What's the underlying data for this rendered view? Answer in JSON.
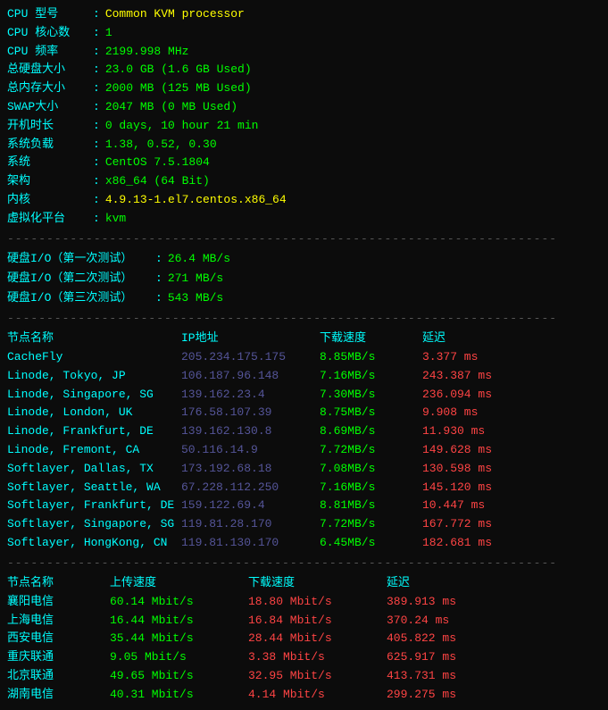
{
  "sysinfo": {
    "rows": [
      {
        "label": "CPU 型号",
        "value": "Common KVM processor",
        "valueClass": "value-yellow"
      },
      {
        "label": "CPU 核心数",
        "value": "1",
        "valueClass": "value"
      },
      {
        "label": "CPU 频率",
        "value": "2199.998 MHz",
        "valueClass": "value"
      },
      {
        "label": "总硬盘大小",
        "value": "23.0 GB (1.6 GB Used)",
        "valueClass": "value"
      },
      {
        "label": "总内存大小",
        "value": "2000 MB (125 MB Used)",
        "valueClass": "value"
      },
      {
        "label": "SWAP大小",
        "value": "2047 MB (0 MB Used)",
        "valueClass": "value"
      },
      {
        "label": "开机时长",
        "value": "0 days, 10 hour 21 min",
        "valueClass": "value"
      },
      {
        "label": "系统负载",
        "value": "1.38, 0.52, 0.30",
        "valueClass": "value"
      },
      {
        "label": "系统",
        "value": "CentOS 7.5.1804",
        "valueClass": "value"
      },
      {
        "label": "架构",
        "value": "x86_64 (64 Bit)",
        "valueClass": "value"
      },
      {
        "label": "内核",
        "value": "4.9.13-1.el7.centos.x86_64",
        "valueClass": "value-yellow"
      },
      {
        "label": "虚拟化平台",
        "value": "kvm",
        "valueClass": "value"
      }
    ]
  },
  "disk_tests": [
    {
      "label": "硬盘I/O（第一次测试）",
      "value": "26.4 MB/s"
    },
    {
      "label": "硬盘I/O（第二次测试）",
      "value": "271 MB/s"
    },
    {
      "label": "硬盘I/O（第三次测试）",
      "value": "543 MB/s"
    }
  ],
  "network_table": {
    "headers": [
      "节点名称",
      "IP地址",
      "下载速度",
      "延迟"
    ],
    "rows": [
      {
        "name": "CacheFly",
        "ip": "205.234.175.175",
        "dl": "8.85MB/s",
        "lat": "3.377 ms"
      },
      {
        "name": "Linode, Tokyo, JP",
        "ip": "106.187.96.148",
        "dl": "7.16MB/s",
        "lat": "243.387 ms"
      },
      {
        "name": "Linode, Singapore, SG",
        "ip": "139.162.23.4",
        "dl": "7.30MB/s",
        "lat": "236.094 ms"
      },
      {
        "name": "Linode, London, UK",
        "ip": "176.58.107.39",
        "dl": "8.75MB/s",
        "lat": "9.908 ms"
      },
      {
        "name": "Linode, Frankfurt, DE",
        "ip": "139.162.130.8",
        "dl": "8.69MB/s",
        "lat": "11.930 ms"
      },
      {
        "name": "Linode, Fremont, CA",
        "ip": "50.116.14.9",
        "dl": "7.72MB/s",
        "lat": "149.628 ms"
      },
      {
        "name": "Softlayer, Dallas, TX",
        "ip": "173.192.68.18",
        "dl": "7.08MB/s",
        "lat": "130.598 ms"
      },
      {
        "name": "Softlayer, Seattle, WA",
        "ip": "67.228.112.250",
        "dl": "7.16MB/s",
        "lat": "145.120 ms"
      },
      {
        "name": "Softlayer, Frankfurt, DE",
        "ip": "159.122.69.4",
        "dl": "8.81MB/s",
        "lat": "10.447 ms"
      },
      {
        "name": "Softlayer, Singapore, SG",
        "ip": "119.81.28.170",
        "dl": "7.72MB/s",
        "lat": "167.772 ms"
      },
      {
        "name": "Softlayer, HongKong, CN",
        "ip": "119.81.130.170",
        "dl": "6.45MB/s",
        "lat": "182.681 ms"
      }
    ]
  },
  "cn_network_table": {
    "headers": [
      "节点名称",
      "上传速度",
      "下载速度",
      "延迟"
    ],
    "rows": [
      {
        "name": "襄阳电信",
        "ul": "60.14 Mbit/s",
        "dl": "18.80 Mbit/s",
        "lat": "389.913 ms"
      },
      {
        "name": "上海电信",
        "ul": "16.44 Mbit/s",
        "dl": "16.84 Mbit/s",
        "lat": "370.24 ms"
      },
      {
        "name": "西安电信",
        "ul": "35.44 Mbit/s",
        "dl": "28.44 Mbit/s",
        "lat": "405.822 ms"
      },
      {
        "name": "重庆联通",
        "ul": "9.05 Mbit/s",
        "dl": "3.38 Mbit/s",
        "lat": "625.917 ms"
      },
      {
        "name": "北京联通",
        "ul": "49.65 Mbit/s",
        "dl": "32.95 Mbit/s",
        "lat": "413.731 ms"
      },
      {
        "name": "湖南电信",
        "ul": "40.31 Mbit/s",
        "dl": "4.14 Mbit/s",
        "lat": "299.275 ms"
      }
    ]
  },
  "divider": "----------------------------------------------------------------------"
}
